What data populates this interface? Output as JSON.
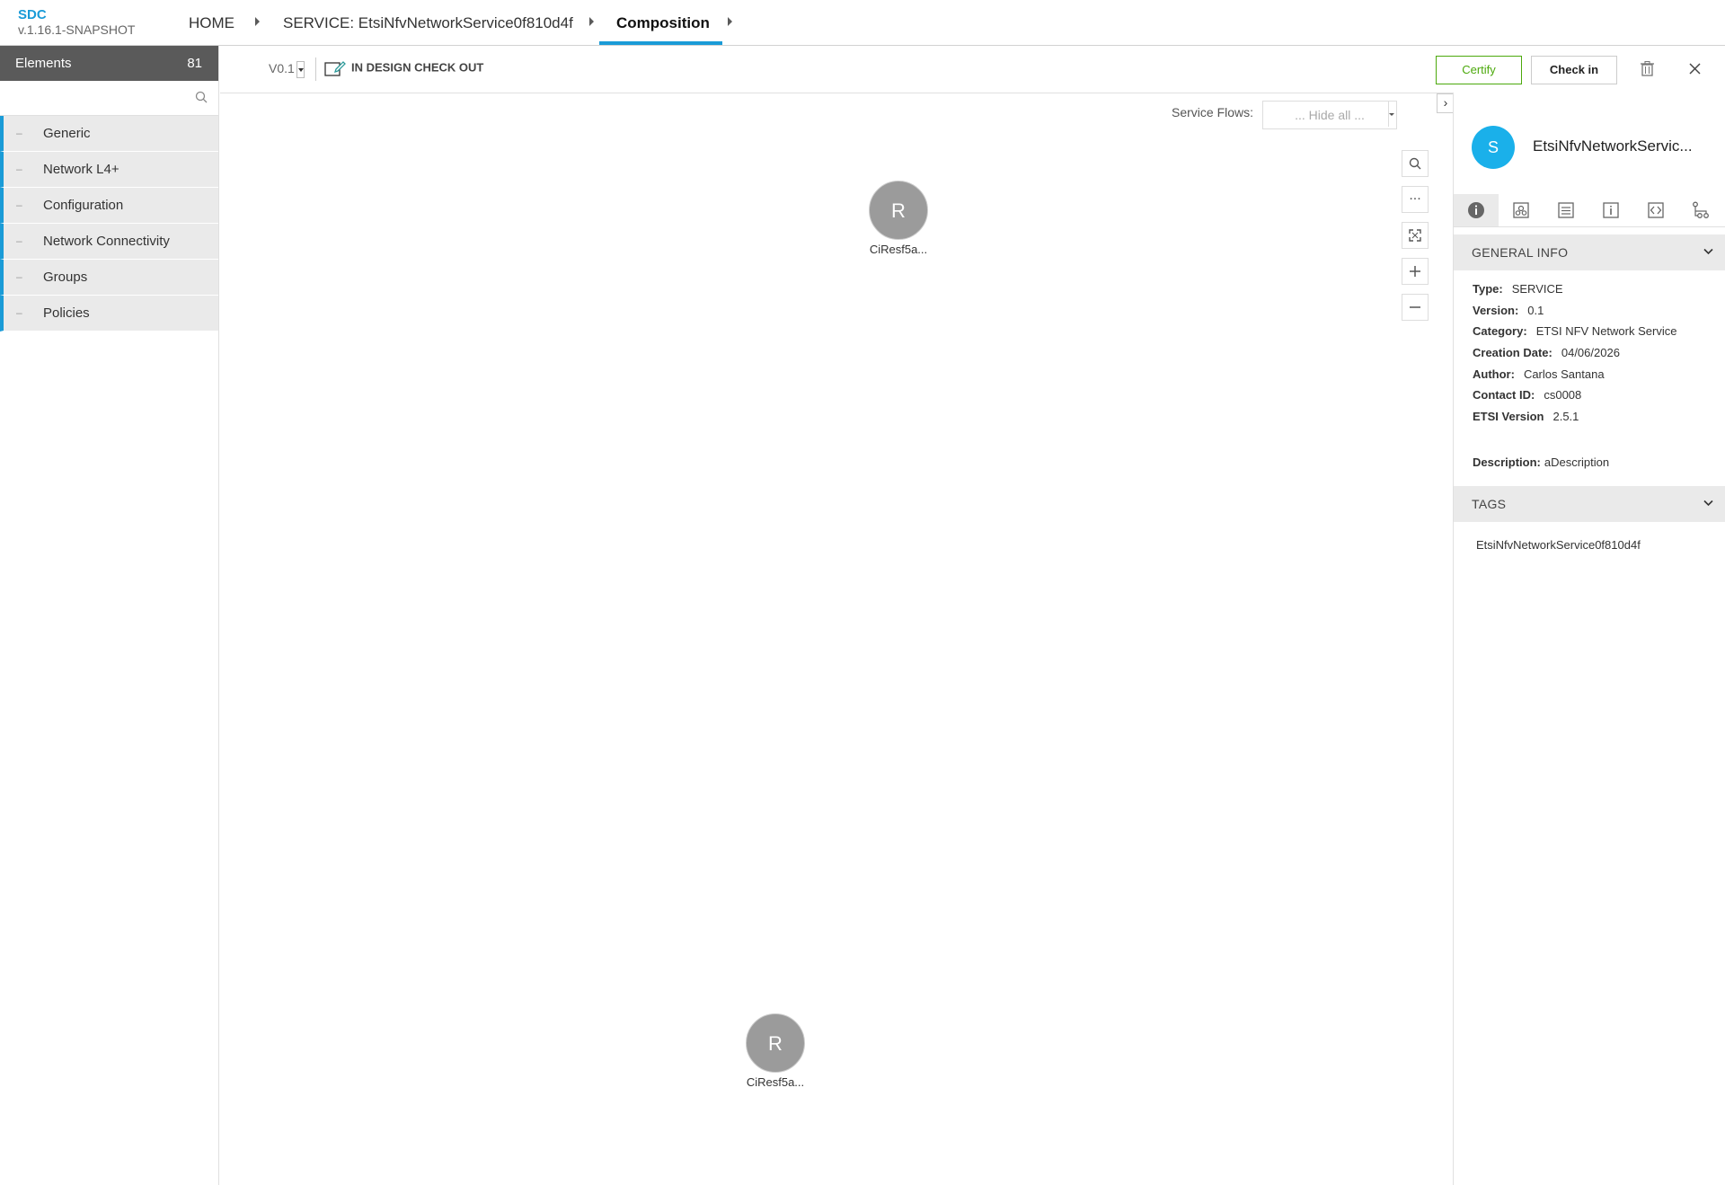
{
  "app": {
    "brand": "SDC",
    "version": "v.1.16.1-SNAPSHOT"
  },
  "breadcrumb": {
    "home": "HOME",
    "service": "SERVICE: EtsiNfvNetworkService0f810d4f",
    "composition": "Composition"
  },
  "palette": {
    "title": "Elements",
    "count": "81",
    "search_placeholder": "",
    "groups": [
      {
        "label": "Generic"
      },
      {
        "label": "Network L4+"
      },
      {
        "label": "Configuration"
      },
      {
        "label": "Network Connectivity"
      },
      {
        "label": "Groups"
      },
      {
        "label": "Policies"
      }
    ]
  },
  "toolbar": {
    "version": "V0.1",
    "status": "IN DESIGN CHECK OUT",
    "certify": "Certify",
    "checkin": "Check in"
  },
  "canvas": {
    "service_flows_label": "Service Flows:",
    "service_flows_value": "... Hide all ...",
    "zoom": {
      "more": "..."
    },
    "nodes": [
      {
        "letter": "R",
        "label": "CiResf5a..."
      },
      {
        "letter": "R",
        "label": "CiResf5a..."
      }
    ]
  },
  "details": {
    "avatar_letter": "S",
    "title": "EtsiNfvNetworkServic...",
    "general_info_header": "GENERAL INFO",
    "fields": [
      {
        "label": "Type:",
        "value": "SERVICE"
      },
      {
        "label": "Version:",
        "value": "0.1"
      },
      {
        "label": "Category:",
        "value": "ETSI NFV Network Service"
      },
      {
        "label": "Creation Date:",
        "value": "04/06/2026"
      },
      {
        "label": "Author:",
        "value": "Carlos Santana"
      },
      {
        "label": "Contact ID:",
        "value": "cs0008"
      },
      {
        "label": "ETSI Version",
        "value": "2.5.1"
      }
    ],
    "description_label": "Description:",
    "description_value": "aDescription",
    "tags_header": "TAGS",
    "tags": [
      "EtsiNfvNetworkService0f810d4f"
    ]
  },
  "colors": {
    "accent": "#1a9bd7",
    "certify": "#4ca90c",
    "avatar": "#1ab0ea",
    "node": "#9b9b9b"
  }
}
